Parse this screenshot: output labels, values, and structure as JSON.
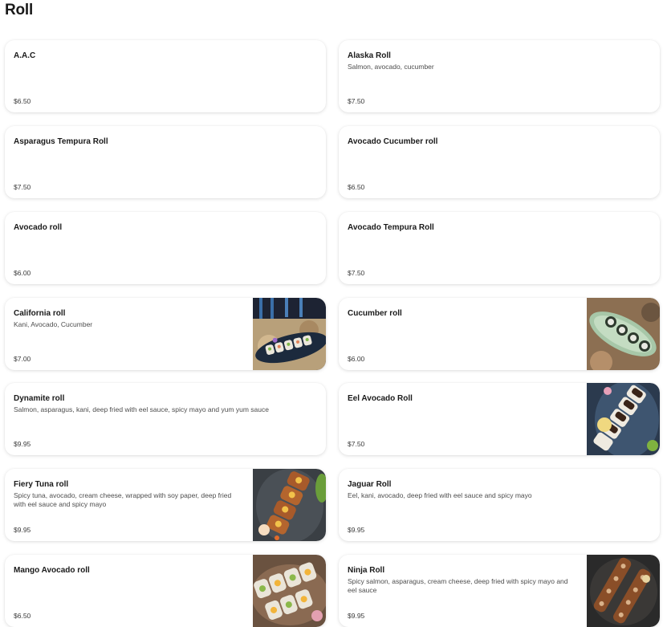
{
  "section": {
    "title": "Roll"
  },
  "items": [
    {
      "name": "A.A.C",
      "description": "",
      "price": "$6.50",
      "image": null
    },
    {
      "name": "Alaska Roll",
      "description": "Salmon, avocado, cucumber",
      "price": "$7.50",
      "image": null
    },
    {
      "name": "Asparagus Tempura Roll",
      "description": "",
      "price": "$7.50",
      "image": null
    },
    {
      "name": "Avocado Cucumber roll",
      "description": "",
      "price": "$6.50",
      "image": null
    },
    {
      "name": "Avocado roll",
      "description": "",
      "price": "$6.00",
      "image": null
    },
    {
      "name": "Avocado Tempura Roll",
      "description": "",
      "price": "$7.50",
      "image": null
    },
    {
      "name": "California roll",
      "description": "Kani, Avocado, Cucumber",
      "price": "$7.00",
      "image": "california-roll-photo"
    },
    {
      "name": "Cucumber roll",
      "description": "",
      "price": "$6.00",
      "image": "cucumber-roll-photo"
    },
    {
      "name": "Dynamite roll",
      "description": "Salmon, asparagus, kani, deep fried with eel sauce, spicy mayo and yum yum sauce",
      "price": "$9.95",
      "image": null
    },
    {
      "name": "Eel Avocado Roll",
      "description": "",
      "price": "$7.50",
      "image": "eel-avocado-roll-photo"
    },
    {
      "name": "Fiery Tuna roll",
      "description": "Spicy tuna, avocado, cream cheese, wrapped with soy paper, deep fried with eel sauce and spicy mayo",
      "price": "$9.95",
      "image": "fiery-tuna-roll-photo"
    },
    {
      "name": "Jaguar Roll",
      "description": "Eel, kani, avocado, deep fried with eel sauce and spicy mayo",
      "price": "$9.95",
      "image": null
    },
    {
      "name": "Mango Avocado roll",
      "description": "",
      "price": "$6.50",
      "image": "mango-avocado-roll-photo"
    },
    {
      "name": "Ninja Roll",
      "description": "Spicy salmon, asparagus, cream cheese, deep fried with spicy mayo and eel sauce",
      "price": "$9.95",
      "image": "ninja-roll-photo"
    }
  ]
}
